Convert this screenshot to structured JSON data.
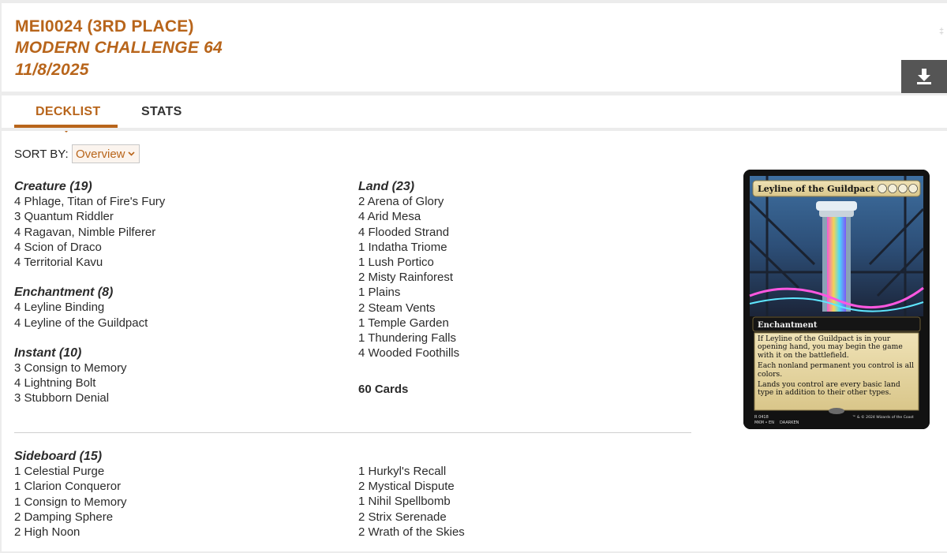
{
  "header": {
    "player": "MEI0024 (3RD PLACE)",
    "event": "MODERN CHALLENGE 64",
    "date": "11/8/2025"
  },
  "tabs": {
    "decklist": "DECKLIST",
    "stats": "STATS"
  },
  "sort": {
    "label": "SORT BY:",
    "selected": "Overview"
  },
  "main_deck": {
    "creature": {
      "title": "Creature (19)",
      "cards": [
        "4 Phlage, Titan of Fire's Fury",
        "3 Quantum Riddler",
        "4 Ragavan, Nimble Pilferer",
        "4 Scion of Draco",
        "4 Territorial Kavu"
      ]
    },
    "enchantment": {
      "title": "Enchantment (8)",
      "cards": [
        "4 Leyline Binding",
        "4 Leyline of the Guildpact"
      ]
    },
    "instant": {
      "title": "Instant (10)",
      "cards": [
        "3 Consign to Memory",
        "4 Lightning Bolt",
        "3 Stubborn Denial"
      ]
    },
    "land": {
      "title": "Land (23)",
      "cards": [
        "2 Arena of Glory",
        "4 Arid Mesa",
        "4 Flooded Strand",
        "1 Indatha Triome",
        "1 Lush Portico",
        "2 Misty Rainforest",
        "1 Plains",
        "2 Steam Vents",
        "1 Temple Garden",
        "1 Thundering Falls",
        "4 Wooded Foothills"
      ]
    },
    "total": "60 Cards"
  },
  "sideboard": {
    "title": "Sideboard (15)",
    "left": [
      "1 Celestial Purge",
      "1 Clarion Conqueror",
      "1 Consign to Memory",
      "2 Damping Sphere",
      "2 High Noon"
    ],
    "right": [
      "1 Hurkyl's Recall",
      "2 Mystical Dispute",
      "1 Nihil Spellbomb",
      "2 Strix Serenade",
      "2 Wrath of the Skies"
    ]
  },
  "card_preview": {
    "name": "Leyline of the Guildpact",
    "type": "Enchantment",
    "rules": [
      "If Leyline of the Guildpact is in your opening hand, you may begin the game with it on the battlefield.",
      "Each nonland permanent you control is all colors.",
      "Lands you control are every basic land type in addition to their other types."
    ],
    "collector": "R 0418",
    "set_lang": "MKM • EN",
    "artist": "DAARKEN",
    "copyright": "™ & © 2024 Wizards of the Coast"
  },
  "colors": {
    "accent": "#b8651b",
    "download_bg": "#555555"
  }
}
